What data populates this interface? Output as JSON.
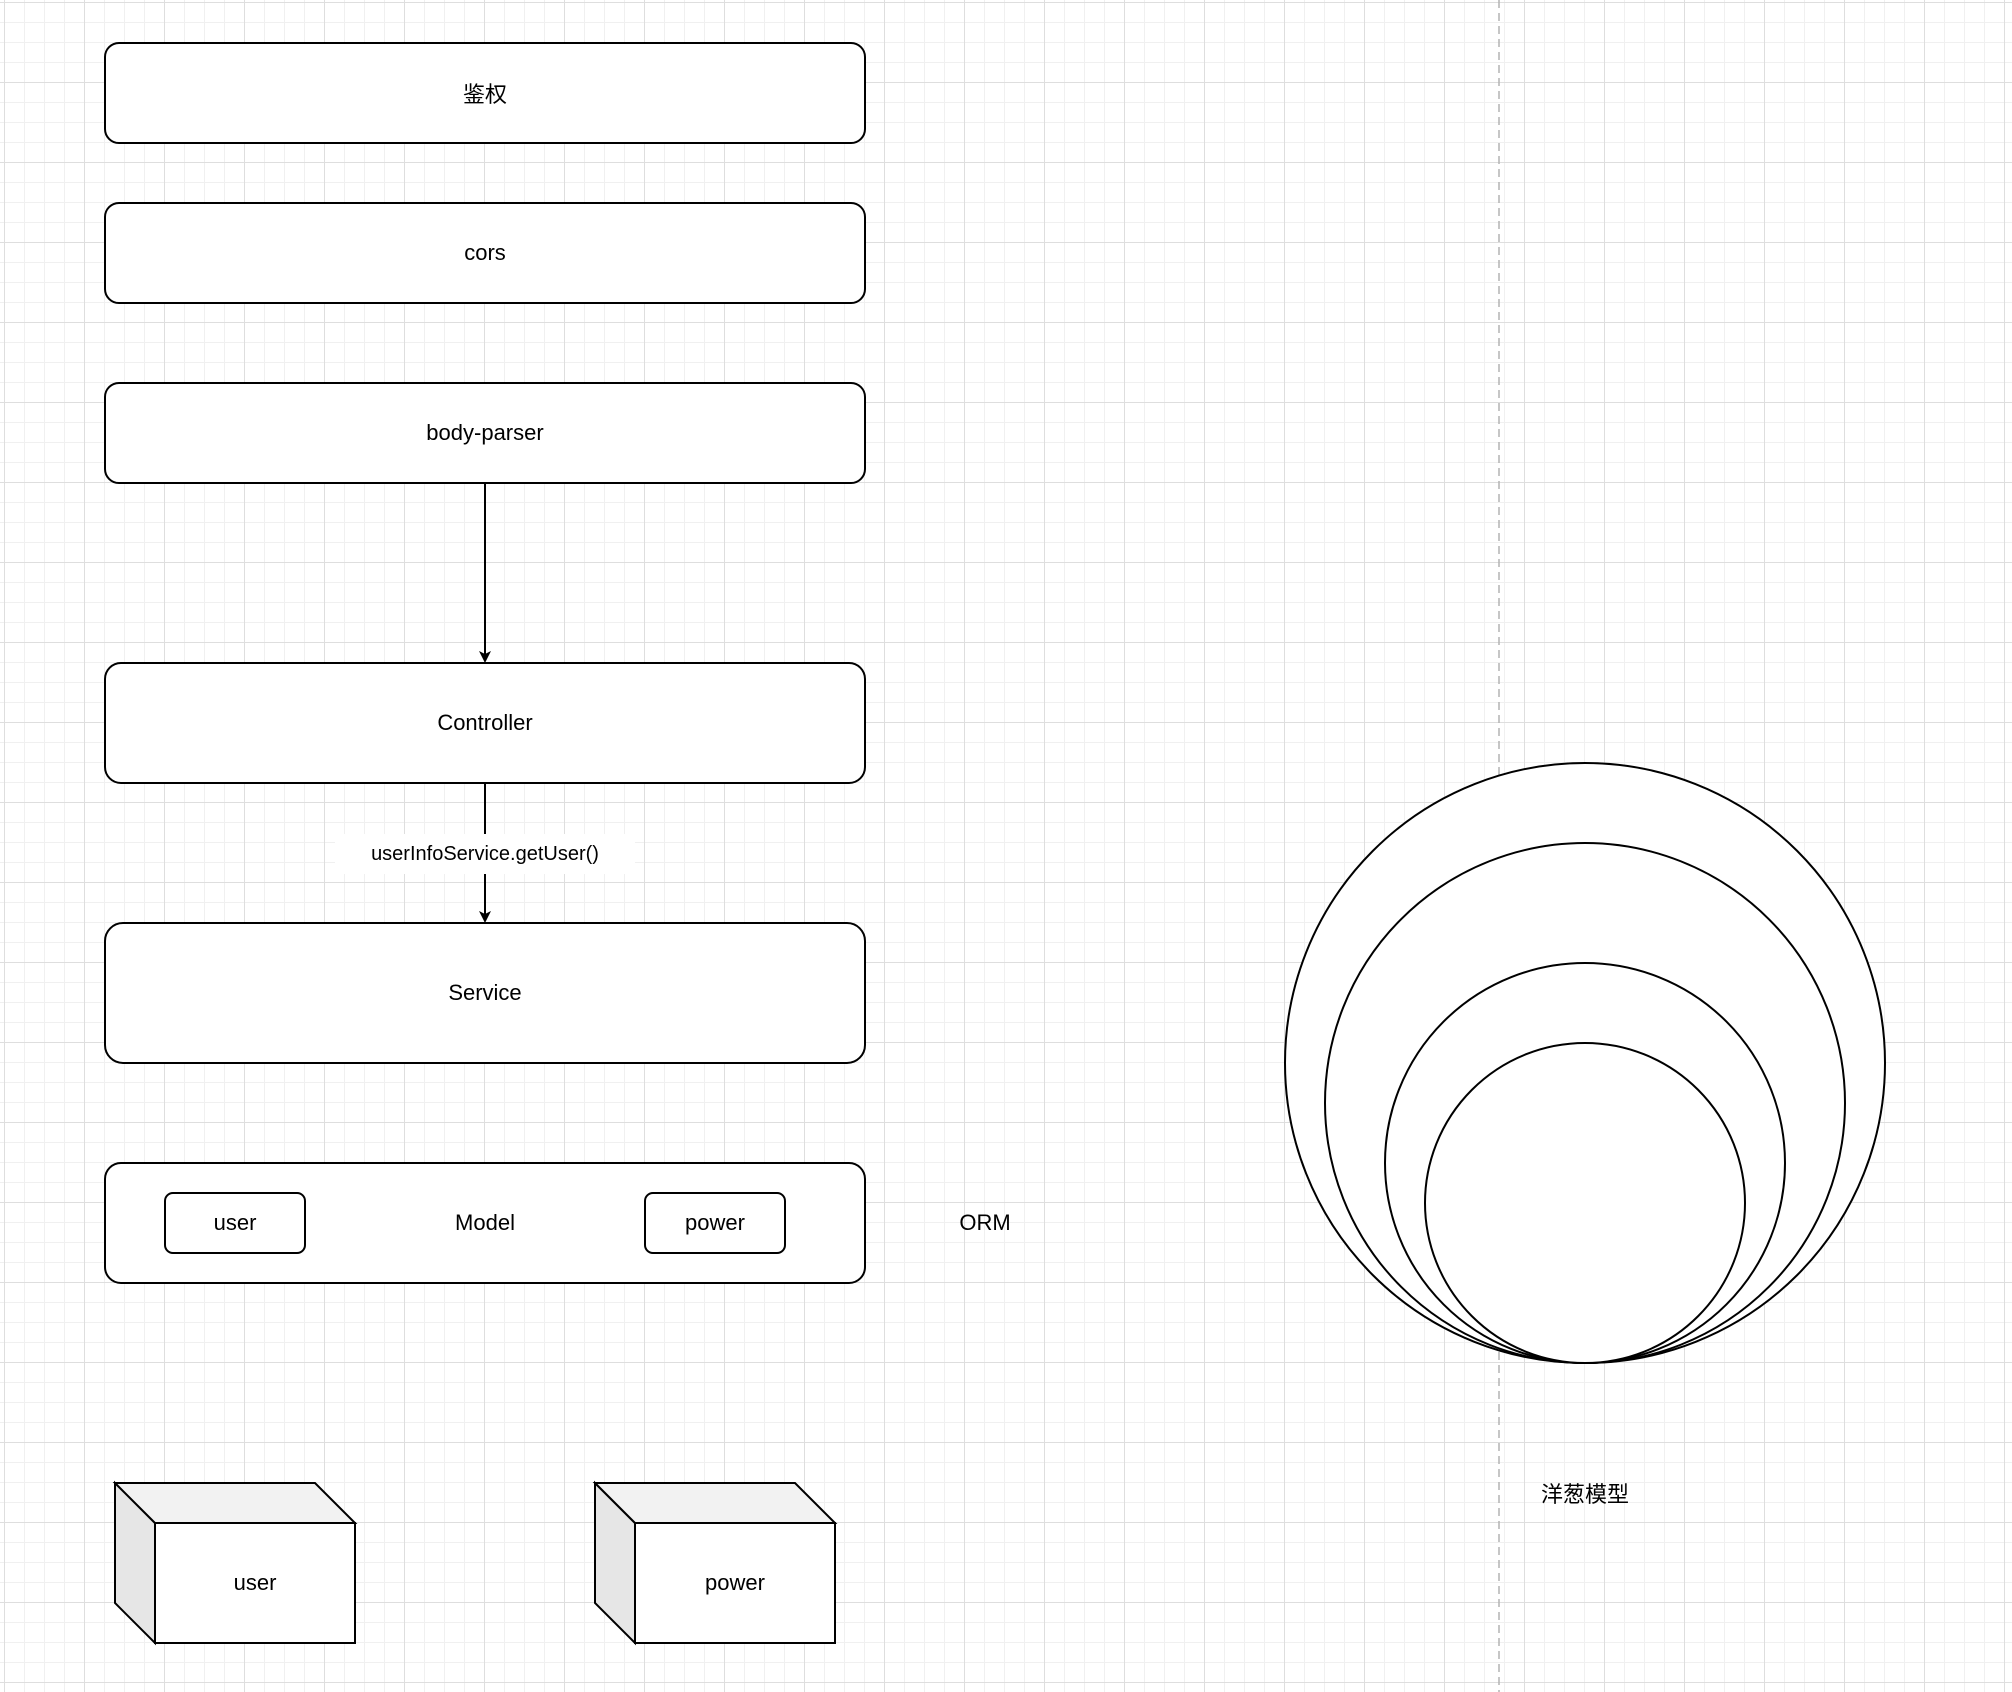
{
  "diagram": {
    "layers": {
      "auth": "鉴权",
      "cors": "cors",
      "body_parser": "body-parser",
      "controller": "Controller",
      "service": "Service",
      "model": "Model"
    },
    "model_items": {
      "user": "user",
      "power": "power"
    },
    "orm_label": "ORM",
    "edge_label": "userInfoService.getUser()",
    "tables": {
      "user": "user",
      "power": "power"
    },
    "onion_label": "洋葱模型",
    "colors": {
      "stroke": "#000000",
      "box_fill": "#ffffff",
      "cube_side": "#e6e6e6",
      "cube_top": "#f2f2f2",
      "guide_line": "#b3b3b3"
    }
  }
}
